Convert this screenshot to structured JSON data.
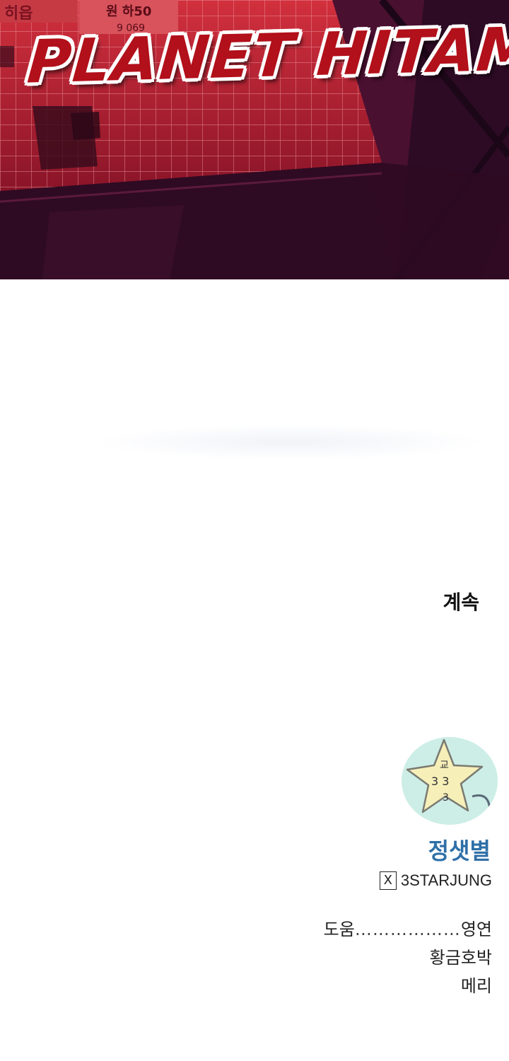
{
  "panel": {
    "title": "PLANET HITAM",
    "sign_text_1": "히읍",
    "sign_text_2": "원 하50",
    "sign_text_3": "9 069"
  },
  "continue_label": "계속",
  "avatar": {
    "mark_1": "교",
    "mark_2": "3 3",
    "mark_3": "3"
  },
  "author": {
    "name": "정샛별",
    "x_glyph": "X",
    "handle": "3STARJUNG"
  },
  "credits": {
    "label": "도움",
    "dots": "………………",
    "names": [
      "영연",
      "황금호박",
      "메리"
    ]
  },
  "colors": {
    "title_red": "#b2101a",
    "author_blue": "#2f6fa8",
    "panel_dark": "#2a0a26"
  }
}
